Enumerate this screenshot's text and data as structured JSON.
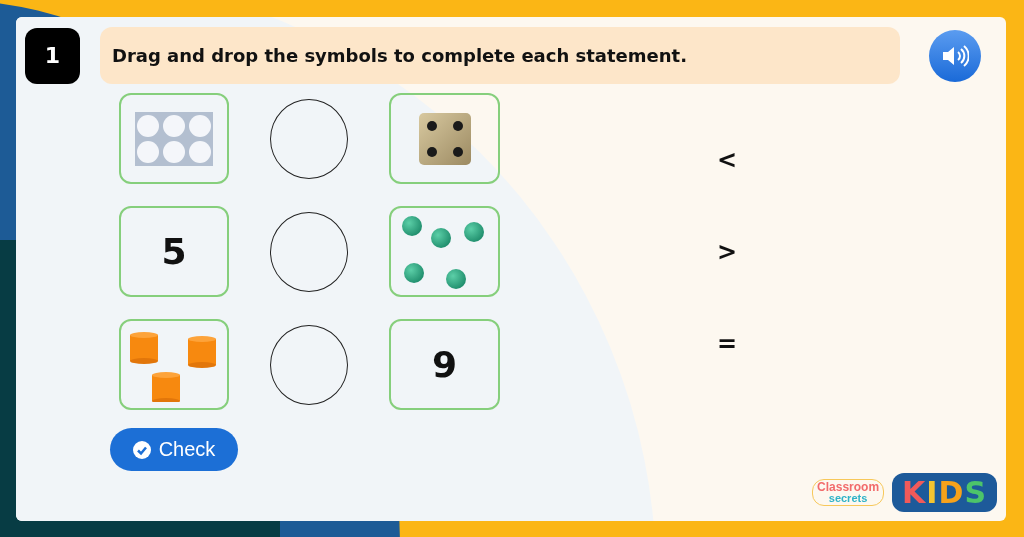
{
  "question": {
    "number": "1",
    "instruction": "Drag and drop the symbols to complete each statement."
  },
  "statements": [
    {
      "left": {
        "kind": "ten-frame"
      },
      "right": {
        "kind": "dice"
      }
    },
    {
      "left": {
        "kind": "number",
        "text": "5"
      },
      "right": {
        "kind": "counters"
      }
    },
    {
      "left": {
        "kind": "cylinders"
      },
      "right": {
        "kind": "number",
        "text": "9"
      }
    }
  ],
  "symbols": [
    "<",
    ">",
    "="
  ],
  "check_button": {
    "label": "Check"
  },
  "logo": {
    "brand_top": "Classroom",
    "brand_bottom": "secrets",
    "badge": "KIDS"
  }
}
